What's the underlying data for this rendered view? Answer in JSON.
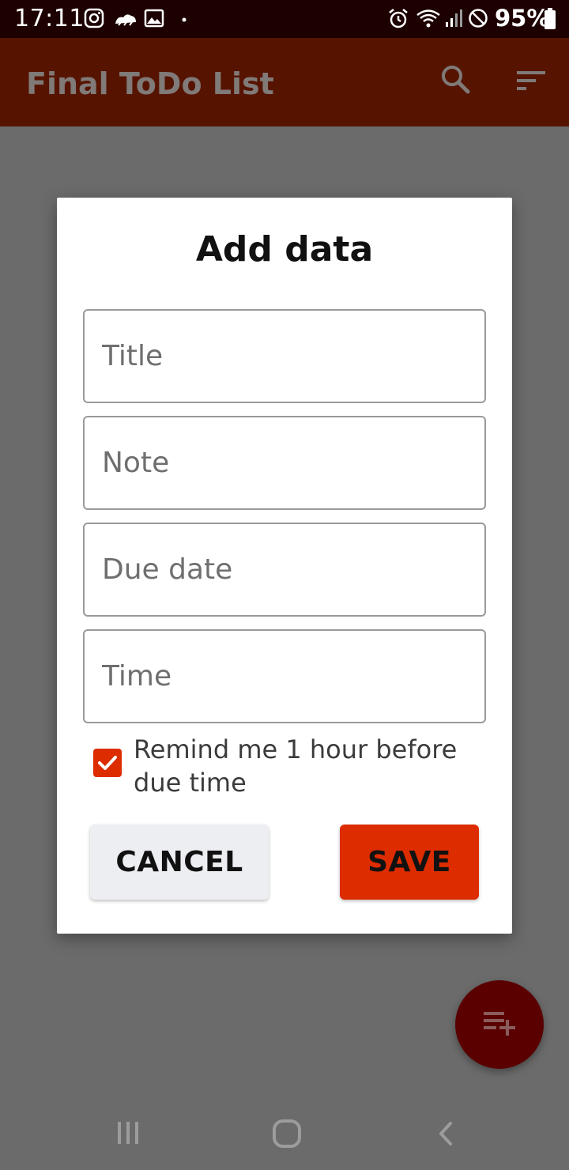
{
  "status_bar": {
    "time": "17:11",
    "battery_percent": "95%",
    "icons": [
      "instagram-icon",
      "weather-icon",
      "image-icon",
      "dot-icon",
      "alarm-icon",
      "wifi-icon",
      "signal-icon",
      "do-not-disturb-icon",
      "battery-icon"
    ]
  },
  "app_bar": {
    "title": "Final ToDo List",
    "icons": [
      "search-icon",
      "sort-icon"
    ]
  },
  "dialog": {
    "title": "Add data",
    "fields": [
      {
        "placeholder": "Title",
        "value": ""
      },
      {
        "placeholder": "Note",
        "value": ""
      },
      {
        "placeholder": "Due date",
        "value": ""
      },
      {
        "placeholder": "Time",
        "value": ""
      }
    ],
    "reminder": {
      "label": "Remind me 1 hour before due time",
      "checked": true
    },
    "buttons": {
      "cancel": "CANCEL",
      "save": "SAVE"
    }
  },
  "fab": {
    "icon": "playlist-add-icon"
  },
  "nav_bar": {
    "icons": [
      "recents-icon",
      "home-icon",
      "back-icon"
    ]
  },
  "colors": {
    "status_bar": "#1d0000",
    "app_bar": "#561400",
    "scrim": "#6b6b6b",
    "accent": "#dd2c00",
    "fab": "#5a0000"
  }
}
